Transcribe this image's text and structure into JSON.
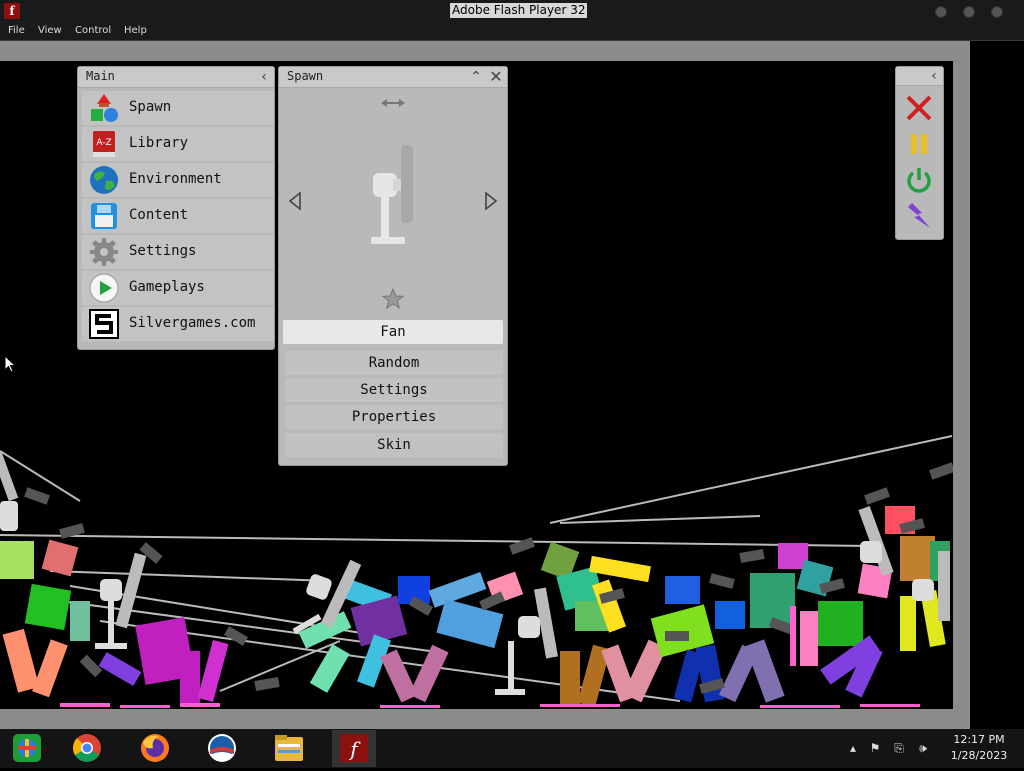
{
  "window": {
    "title": "Adobe Flash Player 32",
    "app_icon": "flash-icon"
  },
  "menu": [
    "File",
    "View",
    "Control",
    "Help"
  ],
  "main_panel": {
    "title": "Main",
    "items": [
      {
        "label": "Spawn",
        "icon": "spawn-shapes-icon"
      },
      {
        "label": "Library",
        "icon": "library-book-icon"
      },
      {
        "label": "Environment",
        "icon": "globe-icon"
      },
      {
        "label": "Content",
        "icon": "floppy-disk-icon"
      },
      {
        "label": "Settings",
        "icon": "gear-icon"
      },
      {
        "label": "Gameplays",
        "icon": "play-icon"
      },
      {
        "label": "Silvergames.com",
        "icon": "silvergames-logo-icon"
      }
    ]
  },
  "spawn_panel": {
    "title": "Spawn",
    "selected_item": "Fan",
    "buttons": [
      "Random",
      "Settings",
      "Properties",
      "Skin"
    ]
  },
  "control_panel": {
    "buttons": [
      {
        "icon": "clear-x-icon",
        "color": "#d02020"
      },
      {
        "icon": "pause-icon",
        "color": "#e8c020"
      },
      {
        "icon": "power-icon",
        "color": "#20a040"
      },
      {
        "icon": "lightning-icon",
        "color": "#8040d0"
      }
    ]
  },
  "taskbar": {
    "apps": [
      "ie-icon",
      "chrome-icon",
      "firefox-icon",
      "campaign-logo-icon",
      "file-explorer-icon",
      "flash-player-icon"
    ],
    "clock": {
      "time": "12:17 PM",
      "date": "1/28/2023"
    }
  }
}
